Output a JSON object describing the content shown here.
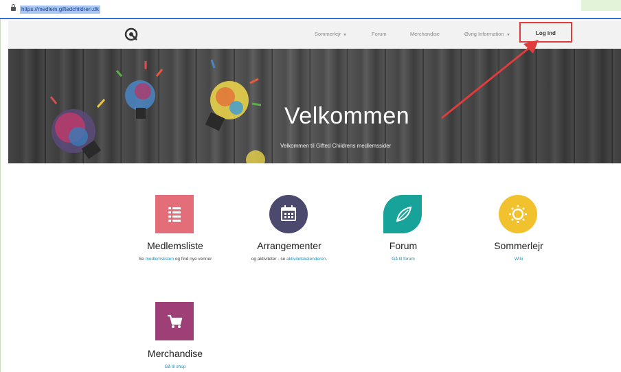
{
  "browser": {
    "url": "https://medlem.giftedchildren.dk"
  },
  "navbar": {
    "items": [
      {
        "label": "Sommerlejr",
        "has_dropdown": true
      },
      {
        "label": "Forum",
        "has_dropdown": false
      },
      {
        "label": "Merchandise",
        "has_dropdown": false
      },
      {
        "label": "Øvrig Information",
        "has_dropdown": true
      }
    ],
    "login_label": "Log ind"
  },
  "hero": {
    "title": "Velkommen",
    "subtitle": "Velkommen til Gifted Childrens medlemssider"
  },
  "tiles": [
    {
      "title": "Medlemsliste",
      "desc_prefix": "Se ",
      "desc_link": "medlemslisten",
      "desc_suffix": " og find nye venner",
      "icon": "list-icon",
      "color": "#e36e7a"
    },
    {
      "title": "Arrangementer",
      "desc_prefix": "og aktiviteter - se ",
      "desc_link": "aktivitetskalenderen",
      "desc_suffix": ".",
      "icon": "calendar-icon",
      "color": "#4b4a6e"
    },
    {
      "title": "Forum",
      "desc_link": "Gå til forum",
      "icon": "leaf-icon",
      "color": "#17a39a"
    },
    {
      "title": "Sommerlejr",
      "desc_link": "Wiki",
      "icon": "sun-icon",
      "color": "#f2c12e"
    },
    {
      "title": "Merchandise",
      "desc_link": "Gå til shop",
      "icon": "cart-icon",
      "color": "#9e3f78"
    }
  ],
  "annotation": {
    "highlight_color": "#e03c3c"
  }
}
